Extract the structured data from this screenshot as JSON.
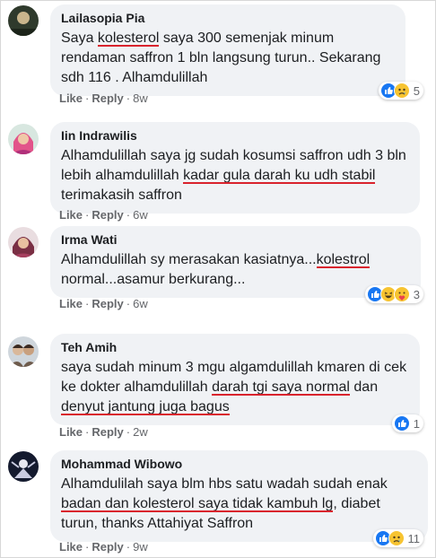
{
  "comments": [
    {
      "author": "Lailasopia Pia",
      "text": [
        "Saya ",
        "kolesterol",
        " saya 300 semenjak minum rendaman saffron 1 bln langsung turun.. Sekarang sdh 116 . Alhamdulillah"
      ],
      "like": "Like",
      "reply": "Reply",
      "time": "8w",
      "reaction_count": "5",
      "reactions": [
        "like-icon",
        "sad-icon"
      ]
    },
    {
      "author": "Iin Indrawilis",
      "text": [
        "Alhamdulillah saya jg sudah kosumsi saffron udh 3 bln lebih alhamdulillah ",
        "kadar gula darah ku udh stabil",
        " terimakasih saffron"
      ],
      "like": "Like",
      "reply": "Reply",
      "time": "6w"
    },
    {
      "author": "Irma Wati",
      "text": [
        "Alhamdulillah sy merasakan kasiatnya...",
        "kolestrol",
        " normal...asamur berkurang..."
      ],
      "like": "Like",
      "reply": "Reply",
      "time": "6w",
      "reaction_count": "3",
      "reactions": [
        "like-icon",
        "haha-icon",
        "care-icon"
      ]
    },
    {
      "author": "Teh Amih",
      "text": [
        "saya sudah minum 3 mgu algamdulillah kmaren di cek ke dokter alhamdulillah ",
        "darah tgi saya normal",
        " dan ",
        "denyut jantung juga bagus",
        ""
      ],
      "like": "Like",
      "reply": "Reply",
      "time": "2w",
      "reaction_count": "1",
      "reactions": [
        "like-icon"
      ]
    },
    {
      "author": "Mohammad Wibowo",
      "text": [
        "Alhamdulilah saya blm hbs satu wadah sudah enak ",
        "badan dan kolesterol saya tidak kambuh lg",
        ", diabet turun, thanks Attahiyat Saffron"
      ],
      "like": "Like",
      "reply": "Reply",
      "time": "9w",
      "reaction_count": "11",
      "reactions": [
        "like-icon",
        "sad-icon"
      ]
    }
  ],
  "colors": {
    "like": "#1877f2",
    "underline": "#d9232d",
    "bubble": "#f0f2f5",
    "meta": "#65676b"
  }
}
